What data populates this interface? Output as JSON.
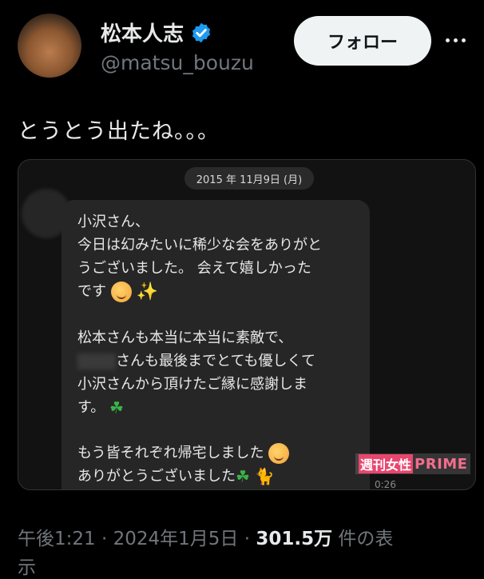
{
  "user": {
    "display_name": "松本人志",
    "handle": "@matsu_bouzu"
  },
  "follow_button_label": "フォロー",
  "tweet_text": "とうとう出たね。。。",
  "media": {
    "date_label": "2015 年 11月9日 (月)",
    "message_lines": [
      "小沢さん、",
      "今日は幻みたいに稀少な会をありがと",
      "うございました。 会えて嬉しかった",
      "です",
      "松本さんも本当に本当に素敵で、",
      "さんも最後までとても優しくて",
      "小沢さんから頂けたご縁に感謝しま",
      "す。",
      "もう皆それぞれ帰宅しました",
      "ありがとうございました"
    ],
    "message_time": "0:26",
    "watermark_jp": "週刊女性",
    "watermark_en": "PRIME"
  },
  "meta": {
    "time": "午後1:21",
    "date": "2024年1月5日",
    "views_count": "301.5万",
    "views_label": "件の表",
    "views_label_cont": "示"
  },
  "colors": {
    "background": "#000000",
    "verified_blue": "#1d9bf0",
    "follow_bg": "#eff3f4",
    "secondary_text": "#71767b"
  }
}
